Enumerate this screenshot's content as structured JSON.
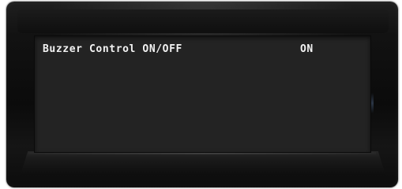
{
  "display": {
    "label": "Buzzer Control ON/OFF",
    "value": "ON"
  },
  "colors": {
    "bezel": "#121212",
    "screen_background": "#232323",
    "text": "#f2f2f2"
  }
}
